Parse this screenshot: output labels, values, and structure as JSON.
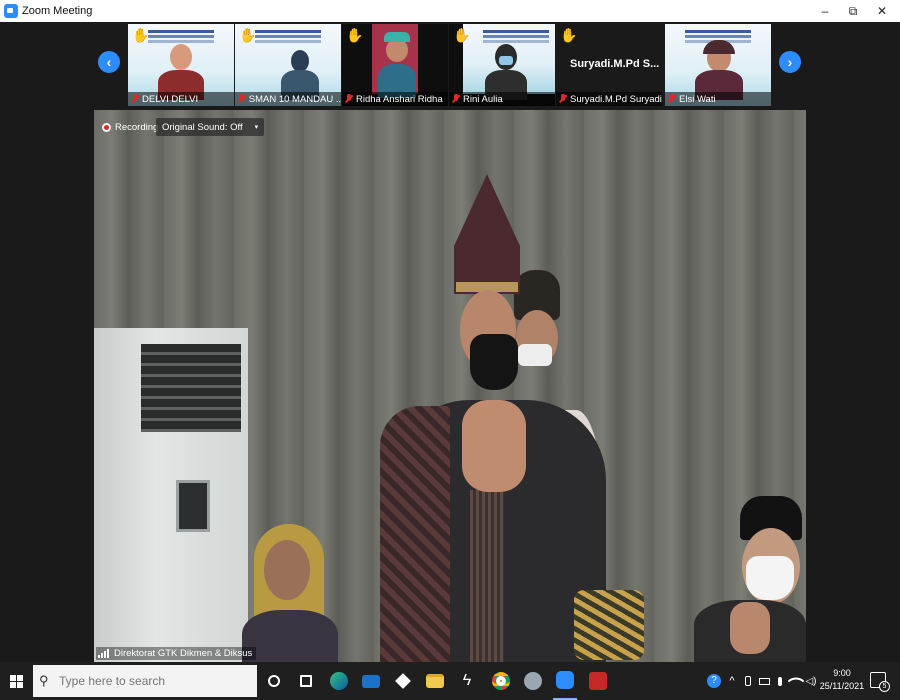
{
  "window": {
    "title": "Zoom Meeting",
    "min_glyph": "–",
    "max_glyph": "⧉",
    "close_glyph": "✕"
  },
  "gallery": {
    "prev_glyph": "‹",
    "next_glyph": "›",
    "participants": [
      {
        "name": "DELVI DELVI",
        "hand_raised": true,
        "muted": true
      },
      {
        "name": "SMAN 10 MANDAU ...",
        "hand_raised": true,
        "muted": true
      },
      {
        "name": "Ridha Anshari Ridha",
        "hand_raised": true,
        "muted": true
      },
      {
        "name": "Rini Aulia",
        "hand_raised": true,
        "muted": true
      },
      {
        "name": "Suryadi.M.Pd Suryadi",
        "display_title": "Suryadi.M.Pd S...",
        "hand_raised": true,
        "muted": true
      },
      {
        "name": "Elsi Wati",
        "hand_raised": false,
        "muted": true
      }
    ]
  },
  "main_video": {
    "recording_label": "Recording",
    "original_sound_label": "Original Sound: Off",
    "caret": "▾",
    "speaker_name": "Direktorat GTK Dikmen & Diksus"
  },
  "taskbar": {
    "search_placeholder": "Type here to search",
    "search_icon": "⚲",
    "time": "9:00",
    "date": "25/11/2021",
    "notification_count": "5",
    "tray_chevron": "^",
    "apps": [
      "task-view-icon",
      "widgets-icon",
      "edge-icon",
      "mail-icon",
      "dropbox-icon",
      "file-explorer-icon",
      "app-bolt-icon",
      "chrome-icon",
      "tool-icon",
      "zoom-icon",
      "app-red-icon"
    ]
  },
  "colors": {
    "accent": "#2d8cff",
    "muted_red": "#e02828",
    "hand_yellow": "#f5c242"
  }
}
